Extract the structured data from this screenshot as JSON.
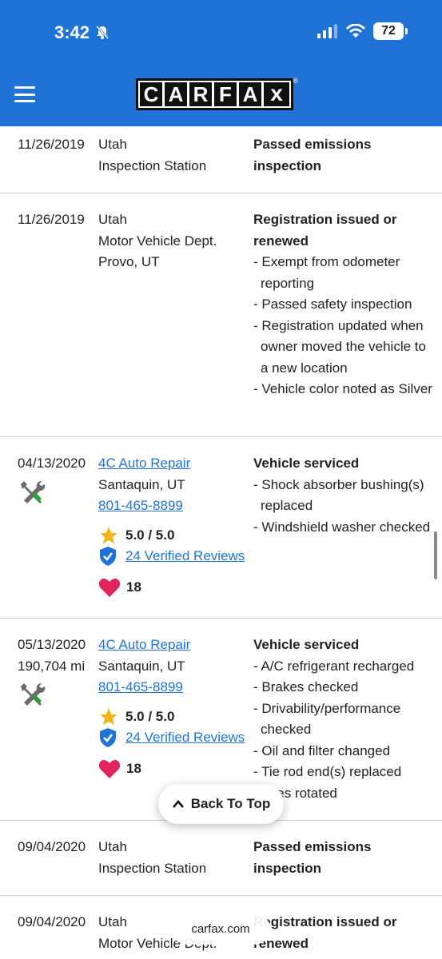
{
  "status": {
    "time": "3:42",
    "battery": "72"
  },
  "header": {
    "logo_letters": [
      "C",
      "A",
      "R",
      "F",
      "A"
    ],
    "logo_x": "x",
    "logo_reg": "®"
  },
  "records": [
    {
      "date": "11/26/2019",
      "source_lines": [
        "Utah",
        "Inspection Station"
      ],
      "title": "Passed emissions inspection",
      "items": []
    },
    {
      "date": "11/26/2019",
      "source_lines": [
        "Utah",
        "Motor Vehicle Dept.",
        "Provo, UT"
      ],
      "title": "Registration issued or renewed",
      "items": [
        "- Exempt from odometer reporting",
        "- Passed safety inspection",
        "- Registration updated when owner moved the vehicle to a new location",
        "- Vehicle color noted as Silver"
      ]
    },
    {
      "date": "04/13/2020",
      "shop": "4C Auto Repair",
      "location": "Santaquin, UT",
      "phone": "801-465-8899",
      "rating": "5.0 / 5.0",
      "reviews": "24 Verified Reviews",
      "favorites": "18",
      "title": "Vehicle serviced",
      "items": [
        "- Shock absorber bushing(s) replaced",
        "- Windshield washer checked"
      ]
    },
    {
      "date": "05/13/2020",
      "mileage": "190,704 mi",
      "shop": "4C Auto Repair",
      "location": "Santaquin, UT",
      "phone": "801-465-8899",
      "rating": "5.0 / 5.0",
      "reviews": "24 Verified Reviews",
      "favorites": "18",
      "title": "Vehicle serviced",
      "items": [
        "- A/C refrigerant recharged",
        "- Brakes checked",
        "- Drivability/performance checked",
        "- Oil and filter changed",
        "- Tie rod end(s) replaced",
        "- Tires rotated"
      ]
    },
    {
      "date": "09/04/2020",
      "source_lines": [
        "Utah",
        "Inspection Station"
      ],
      "title": "Passed emissions inspection",
      "items": []
    },
    {
      "date": "09/04/2020",
      "source_lines": [
        "Utah",
        "Motor Vehicle Dept."
      ],
      "title": "Registration issued or renewed",
      "items": []
    }
  ],
  "back_to_top": "Back To Top",
  "url": "carfax.com"
}
